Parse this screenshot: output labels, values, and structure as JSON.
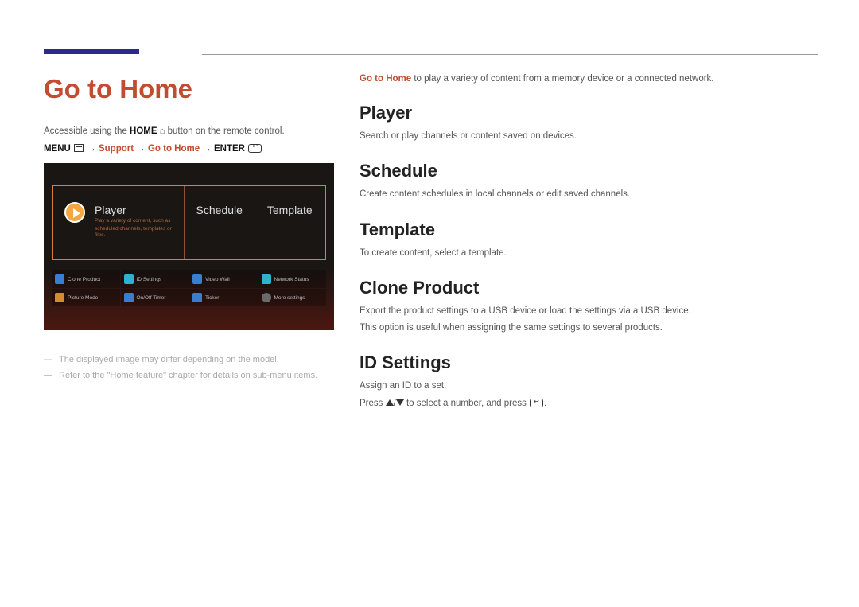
{
  "header": {
    "title": "Go to Home"
  },
  "left": {
    "accessible_pre": "Accessible using the ",
    "accessible_bold": "HOME",
    "accessible_post": " button on the remote control.",
    "path": {
      "menu": "MENU",
      "arrow": " → ",
      "support": "Support",
      "gotohome": "Go to Home",
      "enter": "ENTER"
    },
    "tv": {
      "player": "Player",
      "player_sub1": "Play a variety of content, such as",
      "player_sub2": "scheduled channels, templates or files.",
      "schedule": "Schedule",
      "template": "Template",
      "grid": [
        {
          "label": "Clone Product",
          "cls": "blue"
        },
        {
          "label": "ID Settings",
          "cls": "cyan"
        },
        {
          "label": "Video Wall",
          "cls": "blue"
        },
        {
          "label": "Network Status",
          "cls": "cyan"
        },
        {
          "label": "Picture Mode",
          "cls": "orange"
        },
        {
          "label": "On/Off Timer",
          "cls": "blue"
        },
        {
          "label": "Ticker",
          "cls": "blue"
        },
        {
          "label": "More settings",
          "cls": "gear"
        }
      ]
    },
    "notes": [
      "The displayed image may differ depending on the model.",
      "Refer to the \"Home feature\" chapter for details on sub-menu items."
    ]
  },
  "right": {
    "intro_bold": "Go to Home",
    "intro_rest": " to play a variety of content from a memory device or a connected network.",
    "sections": [
      {
        "h": "Player",
        "p": "Search or play channels or content saved on devices."
      },
      {
        "h": "Schedule",
        "p": "Create content schedules in local channels or edit saved channels."
      },
      {
        "h": "Template",
        "p": "To create content, select a template."
      },
      {
        "h": "Clone Product",
        "p": "Export the product settings to a USB device or load the settings via a USB device.",
        "p2": "This option is useful when assigning the same settings to several products."
      },
      {
        "h": "ID Settings",
        "p": "Assign an ID to a set.",
        "press_pre": "Press ",
        "press_mid": "/",
        "press_post": " to select a number, and press "
      }
    ]
  }
}
